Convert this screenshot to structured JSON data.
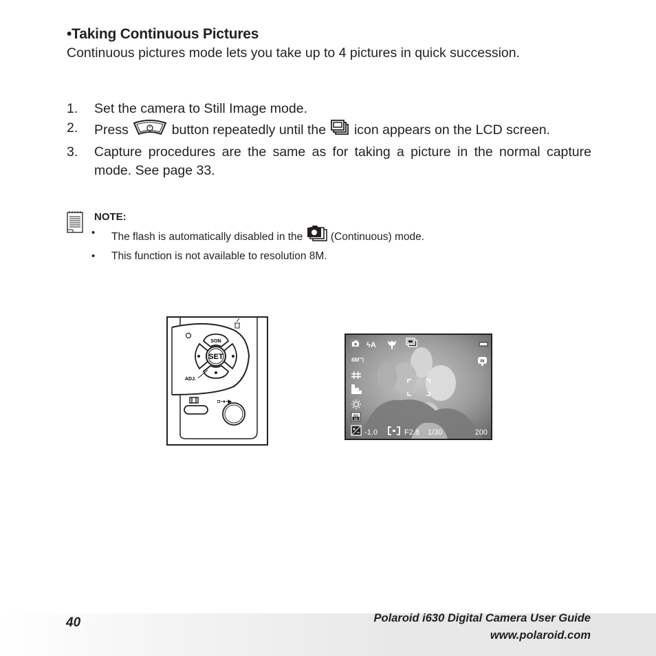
{
  "section": {
    "title": "•Taking Continuous Pictures",
    "intro": "Continuous pictures mode lets you take up to 4 pictures in quick succession."
  },
  "steps": [
    {
      "num": "1.",
      "text": "Set the camera to Still Image mode."
    },
    {
      "num": "2.",
      "text_before": "Press",
      "icon1": "self-timer-button-icon",
      "text_middle": "button repeatedly until the",
      "icon2": "continuous-mode-icon",
      "text_after": "icon appears on the LCD screen."
    },
    {
      "num": "3.",
      "text": "Capture procedures are the same as for taking a picture in the normal capture mode. See page 33."
    }
  ],
  "note": {
    "icon": "notepad-icon",
    "title": "NOTE:",
    "items": [
      {
        "text_before": "The flash is automatically disabled in the",
        "icon": "continuous-camera-icon",
        "text_after": "(Continuous) mode."
      },
      {
        "text": "This function is not available to resolution 8M."
      }
    ]
  },
  "camera_back": {
    "buttons": {
      "up": "SON",
      "center": "SET",
      "adj": "ADJ."
    }
  },
  "lcd_screen": {
    "resolution": "6M",
    "storage": "IN",
    "exposure_comp": "-1.0",
    "aperture": "F2.8",
    "shutter": "1/30",
    "shots_remaining": "200",
    "iso": "ISO 50",
    "top_icons": [
      "camera-mode-icon",
      "flash-auto-icon",
      "macro-icon",
      "continuous-mode-icon"
    ],
    "flash_label": "ϟA"
  },
  "footer": {
    "page_number": "40",
    "guide_title": "Polaroid i630 Digital Camera User Guide",
    "url": "www.polaroid.com"
  }
}
